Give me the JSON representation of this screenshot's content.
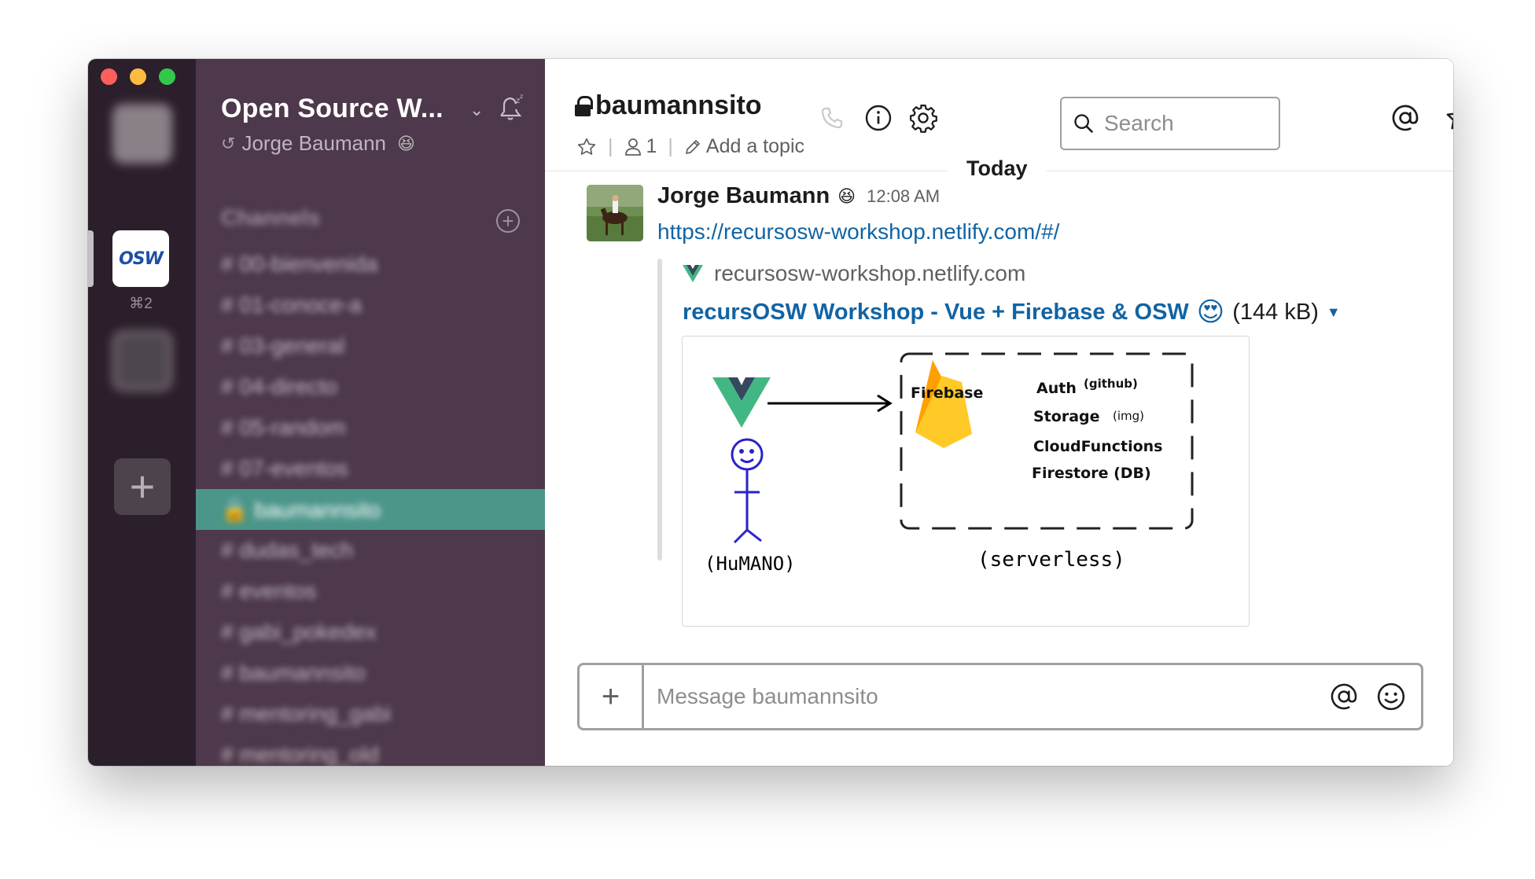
{
  "rail": {
    "active_workspace_label": "OSW",
    "active_workspace_shortcut": "⌘2",
    "add_workspace_label": "+"
  },
  "sidebar": {
    "team_name": "Open Source W...",
    "user_name": "Jorge Baumann",
    "channels_header": "Channels",
    "channels": [
      {
        "label": "# 00-bienvenida"
      },
      {
        "label": "# 01-conoce-a"
      },
      {
        "label": "# 03-general"
      },
      {
        "label": "# 04-directo"
      },
      {
        "label": "# 05-random"
      },
      {
        "label": "# 07-eventos"
      },
      {
        "label": "🔒 baumannsito",
        "active": true
      },
      {
        "label": "# dudas_tech"
      },
      {
        "label": "# eventos"
      },
      {
        "label": "# gabi_pokedex"
      },
      {
        "label": "# baumannsito"
      },
      {
        "label": "# mentoring_gabi"
      },
      {
        "label": "# mentoring_old"
      }
    ]
  },
  "header": {
    "channel_name": "baumannsito",
    "member_count": "1",
    "add_topic": "Add a topic",
    "search_placeholder": "Search"
  },
  "messages": {
    "day_divider": "Today",
    "author": "Jorge Baumann",
    "time": "12:08 AM",
    "link": "https://recursosw-workshop.netlify.com/#/",
    "attachment": {
      "site": "recursosw-workshop.netlify.com",
      "title": "recursOSW Workshop - Vue + Firebase & OSW",
      "emoji": "😍",
      "size": "(144 kB)",
      "image": {
        "firebase_label": "Firebase",
        "services": [
          "Auth",
          "Storage",
          "CloudFunctions",
          "Firestore (DB)"
        ],
        "auth_note": "(github)",
        "storage_note": "(img)",
        "human_label": "(HuMANO)",
        "serverless_label": "(serverless)"
      }
    }
  },
  "composer": {
    "placeholder": "Message baumannsito"
  },
  "colors": {
    "rail_bg": "#2c1f2c",
    "sidebar_bg": "#4d394b",
    "active_channel_bg": "#4c9689",
    "link_blue": "#1264a3"
  }
}
